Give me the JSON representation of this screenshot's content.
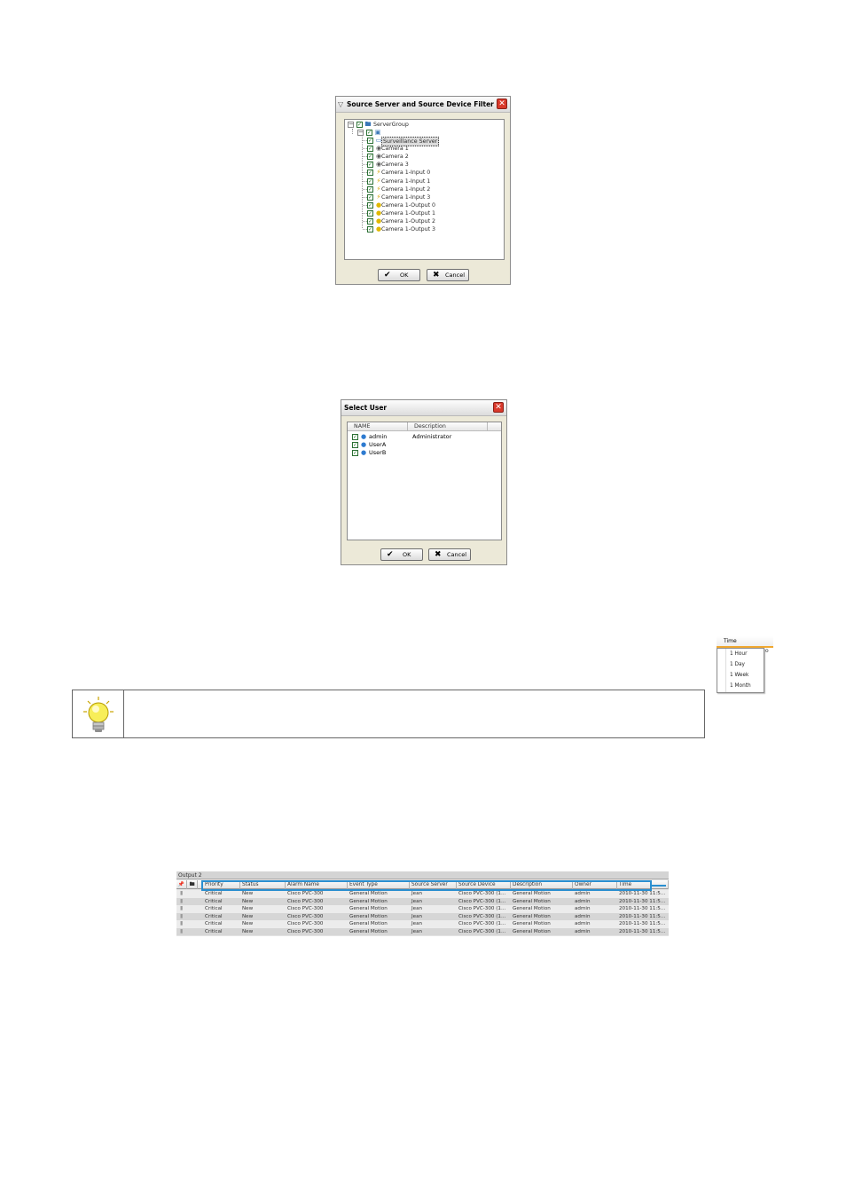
{
  "source_filter_dialog": {
    "title": "Source Server and Source Device Filter",
    "tree": {
      "root": "ServerGroup",
      "server": "",
      "nodes": [
        "Surveillance Server",
        "Camera 1",
        "Camera 2",
        "Camera 3",
        "Camera 1-Input 0",
        "Camera 1-Input 1",
        "Camera 1-Input 2",
        "Camera 1-Input 3",
        "Camera 1-Output 0",
        "Camera 1-Output 1",
        "Camera 1-Output 2",
        "Camera 1-Output 3"
      ],
      "node_icons": [
        "monitor-icon",
        "camera-icon",
        "camera-icon",
        "camera-icon",
        "input-icon",
        "input-icon",
        "input-icon",
        "input-icon",
        "output-icon",
        "output-icon",
        "output-icon",
        "output-icon"
      ]
    },
    "ok_label": "OK",
    "cancel_label": "Cancel"
  },
  "select_user_dialog": {
    "title": "Select User",
    "columns": [
      "NAME",
      "Description"
    ],
    "users": [
      {
        "name": "admin",
        "description": "Administrator",
        "checked": true
      },
      {
        "name": "UserA",
        "description": "",
        "checked": true
      },
      {
        "name": "UserB",
        "description": "",
        "checked": true
      }
    ],
    "ok_label": "OK",
    "cancel_label": "Cancel"
  },
  "time_dropdown": {
    "header": "Time",
    "header_tail": "o",
    "options": [
      "1 Hour",
      "1 Day",
      "1 Week",
      "1 Month"
    ]
  },
  "tip": {
    "icon": "lightbulb-icon"
  },
  "alarm_table": {
    "title": "Output 2",
    "columns": [
      "Priority",
      "Status",
      "Alarm Name",
      "Event Type",
      "Source Server",
      "Source Device",
      "Description",
      "Owner",
      "Time"
    ],
    "rows": [
      [
        "Critical",
        "New",
        "Cisco PVC-300",
        "General Motion",
        "Jean",
        "Cisco PVC-300 (1...",
        "General Motion",
        "admin",
        "2010-11-30 11:5..."
      ],
      [
        "Critical",
        "New",
        "Cisco PVC-300",
        "General Motion",
        "Jean",
        "Cisco PVC-300 (1...",
        "General Motion",
        "admin",
        "2010-11-30 11:5..."
      ],
      [
        "Critical",
        "New",
        "Cisco PVC-300",
        "General Motion",
        "Jean",
        "Cisco PVC-300 (1...",
        "General Motion",
        "admin",
        "2010-11-30 11:5..."
      ],
      [
        "Critical",
        "New",
        "Cisco PVC-300",
        "General Motion",
        "Jean",
        "Cisco PVC-300 (1...",
        "General Motion",
        "admin",
        "2010-11-30 11:5..."
      ],
      [
        "Critical",
        "New",
        "Cisco PVC-300",
        "General Motion",
        "Jean",
        "Cisco PVC-300 (1...",
        "General Motion",
        "admin",
        "2010-11-30 11:5..."
      ],
      [
        "Critical",
        "New",
        "Cisco PVC-300",
        "General Motion",
        "Jean",
        "Cisco PVC-300 (1...",
        "General Motion",
        "admin",
        "2010-11-30 11:5..."
      ]
    ],
    "highlight_color": "#2a8fd0"
  }
}
